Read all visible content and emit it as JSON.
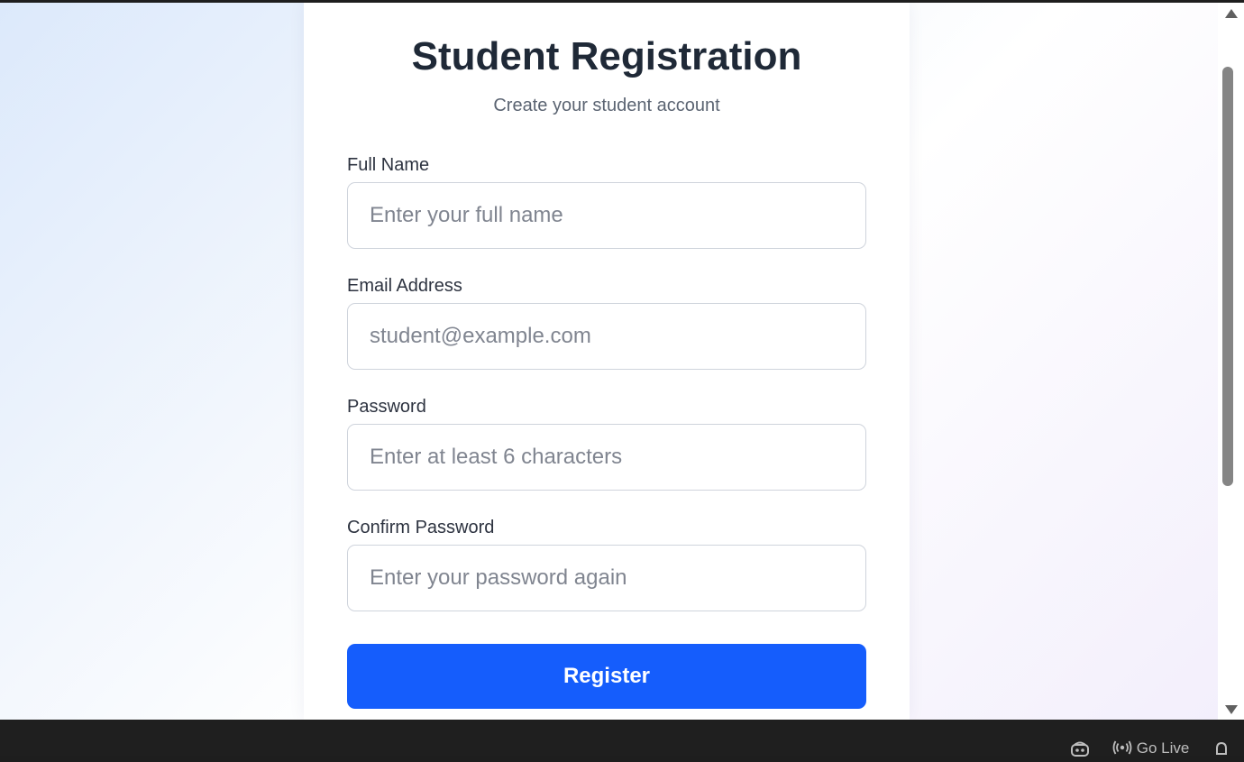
{
  "form": {
    "title": "Student Registration",
    "subtitle": "Create your student account",
    "fields": [
      {
        "label": "Full Name",
        "placeholder": "Enter your full name",
        "type": "text"
      },
      {
        "label": "Email Address",
        "placeholder": "student@example.com",
        "type": "email"
      },
      {
        "label": "Password",
        "placeholder": "Enter at least 6 characters",
        "type": "password"
      },
      {
        "label": "Confirm Password",
        "placeholder": "Enter your password again",
        "type": "password"
      }
    ],
    "submit_label": "Register"
  },
  "statusbar": {
    "go_live_label": "Go Live",
    "icons": [
      "copilot-icon",
      "broadcast-icon",
      "bell-icon"
    ]
  },
  "colors": {
    "accent": "#155dfc",
    "title": "#1f2937",
    "statusbar": "#1f1f1f"
  }
}
